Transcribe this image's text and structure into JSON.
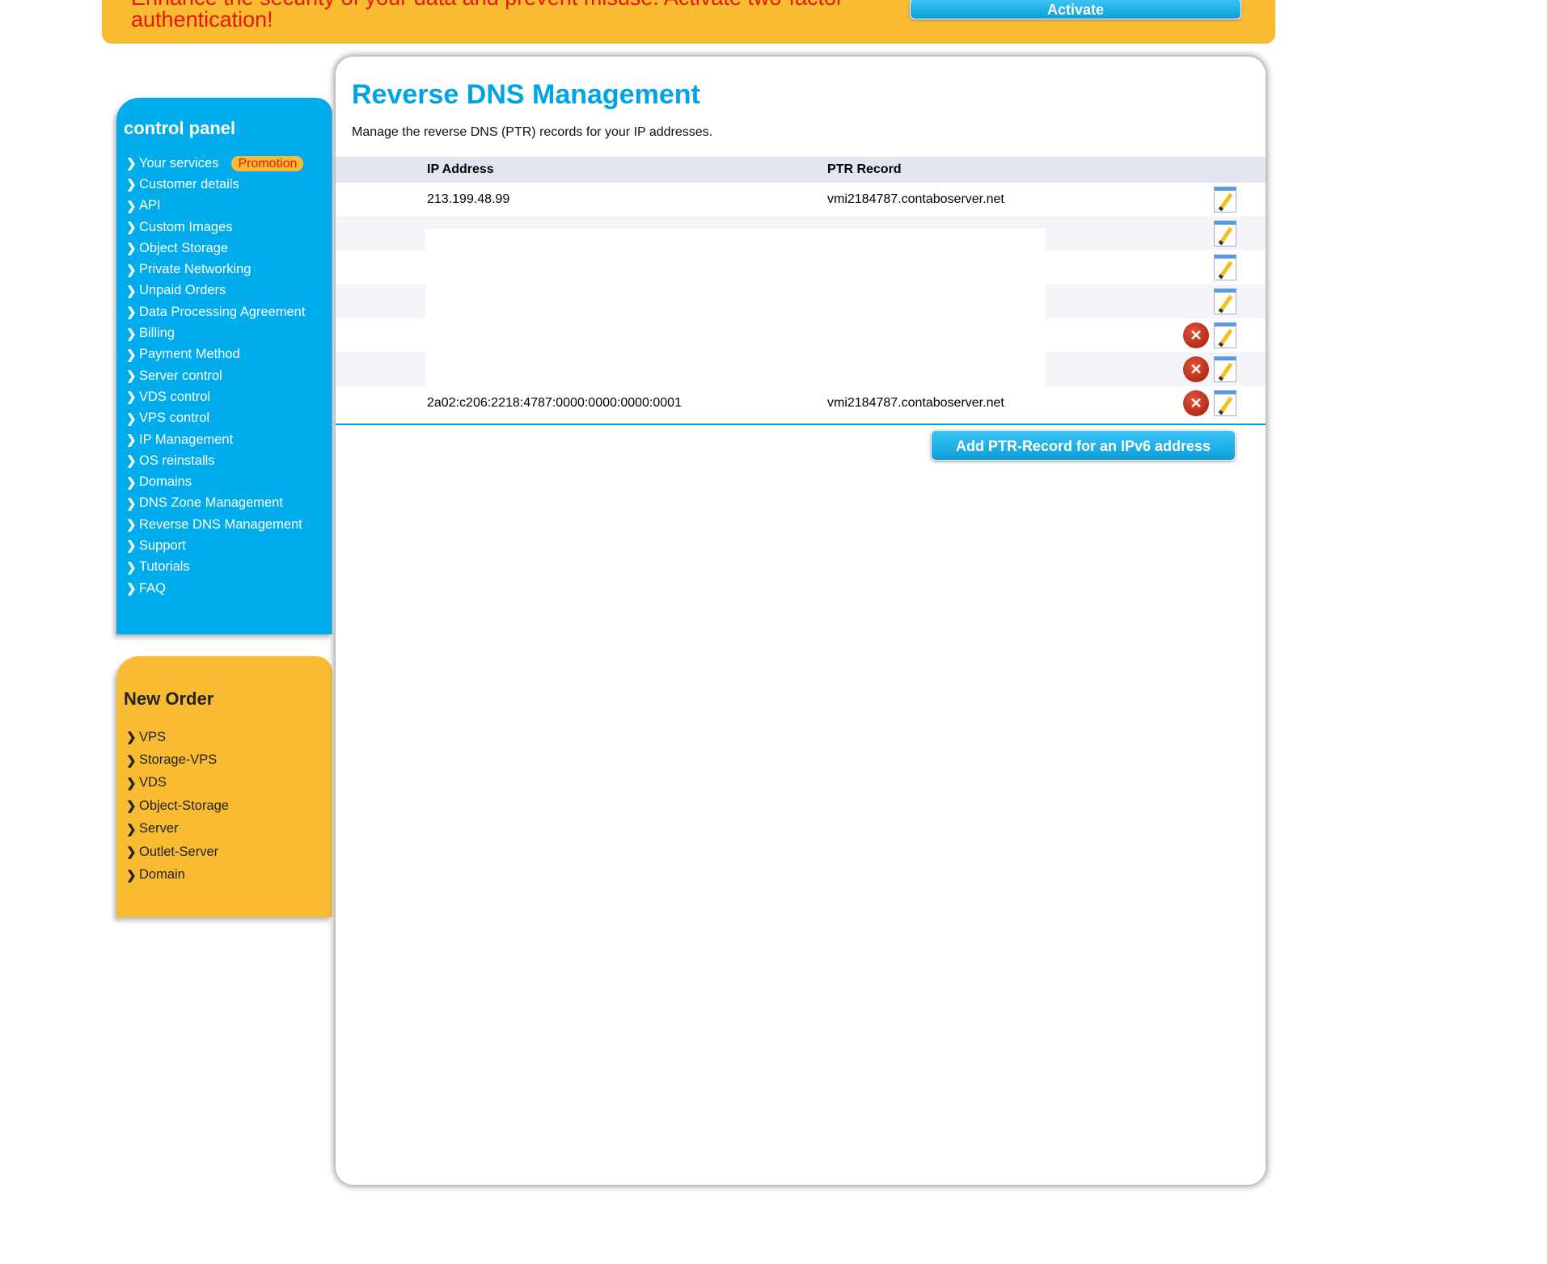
{
  "banner": {
    "text": "Enhance the security of your data and prevent misuse. Activate two-factor authentication!",
    "button": "Activate"
  },
  "sidebar": {
    "title": "control panel",
    "promo_badge": "Promotion",
    "items": [
      "Your services",
      "Customer details",
      "API",
      "Custom Images",
      "Object Storage",
      "Private Networking",
      "Unpaid Orders",
      "Data Processing Agreement",
      "Billing",
      "Payment Method",
      "Server control",
      "VDS control",
      "VPS control",
      "IP Management",
      "OS reinstalls",
      "Domains",
      "DNS Zone Management",
      "Reverse DNS Management",
      "Support",
      "Tutorials",
      "FAQ"
    ]
  },
  "new_order": {
    "title": "New Order",
    "items": [
      "VPS",
      "Storage-VPS",
      "VDS",
      "Object-Storage",
      "Server",
      "Outlet-Server",
      "Domain"
    ]
  },
  "main": {
    "title": "Reverse DNS Management",
    "description": "Manage the reverse DNS (PTR) records for your IP addresses.",
    "columns": [
      "IP Address",
      "PTR Record"
    ],
    "rows": [
      {
        "ip": "213.199.48.99",
        "ptr": "vmi2184787.contaboserver.net",
        "deletable": false
      },
      {
        "ip": "",
        "ptr": "",
        "deletable": false
      },
      {
        "ip": "",
        "ptr": "",
        "deletable": false
      },
      {
        "ip": "",
        "ptr": "",
        "deletable": false
      },
      {
        "ip": "",
        "ptr": "",
        "deletable": true
      },
      {
        "ip": "",
        "ptr": "",
        "deletable": true
      },
      {
        "ip": "2a02:c206:2218:4787:0000:0000:0000:0001",
        "ptr": "vmi2184787.contaboserver.net",
        "deletable": true
      }
    ],
    "add_button": "Add PTR-Record for an IPv6 address"
  },
  "colors": {
    "accent": "#00a4e4",
    "banner": "#f8bb32",
    "warning_text": "#e8170c"
  }
}
